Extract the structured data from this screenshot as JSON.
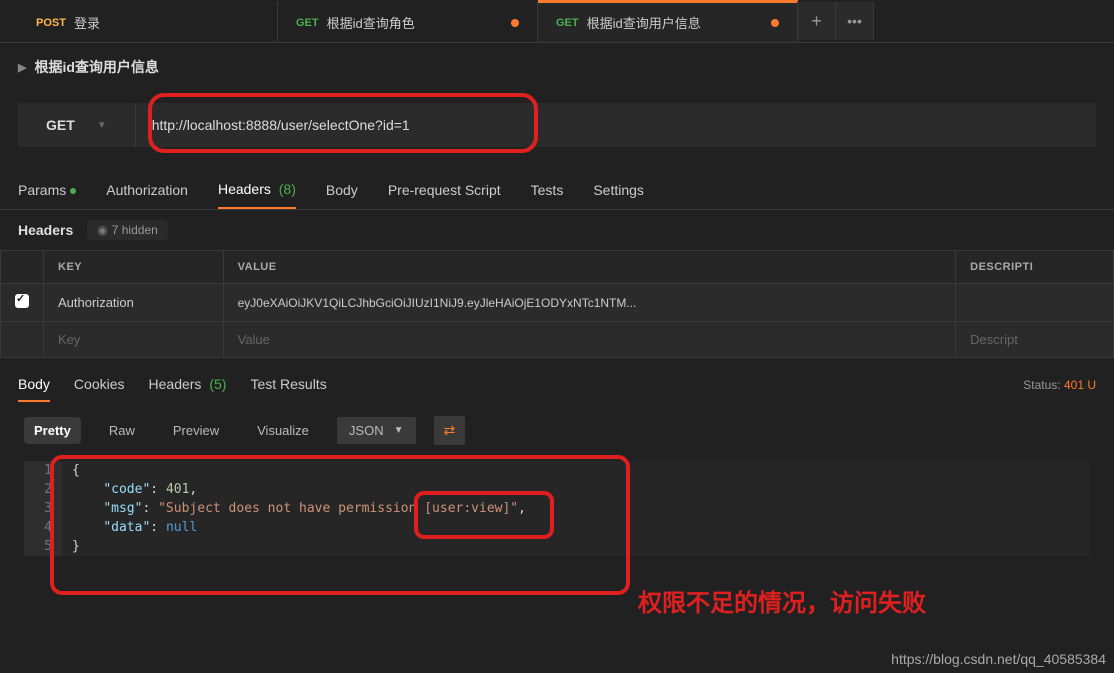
{
  "tabs": [
    {
      "method": "POST",
      "label": "登录",
      "modified": false
    },
    {
      "method": "GET",
      "label": "根据id查询角色",
      "modified": true
    },
    {
      "method": "GET",
      "label": "根据id查询用户信息",
      "modified": true,
      "active": true
    }
  ],
  "breadcrumb": "根据id查询用户信息",
  "request": {
    "method": "GET",
    "url": "http://localhost:8888/user/selectOne?id=1"
  },
  "req_tabs": {
    "params": "Params",
    "authorization": "Authorization",
    "headers": "Headers",
    "headers_count": "(8)",
    "body": "Body",
    "prerequest": "Pre-request Script",
    "tests": "Tests",
    "settings": "Settings"
  },
  "headers_sub": {
    "title": "Headers",
    "hidden": "7 hidden"
  },
  "table": {
    "cols": {
      "key": "KEY",
      "value": "VALUE",
      "desc": "DESCRIPTI"
    },
    "row": {
      "key": "Authorization",
      "value": "eyJ0eXAiOiJKV1QiLCJhbGciOiJIUzI1NiJ9.eyJleHAiOjE1ODYxNTc1NTM..."
    },
    "ph": {
      "key": "Key",
      "value": "Value",
      "desc": "Descript"
    }
  },
  "resp_tabs": {
    "body": "Body",
    "cookies": "Cookies",
    "headers": "Headers",
    "headers_count": "(5)",
    "tests": "Test Results"
  },
  "status": {
    "label": "Status:",
    "value": "401 U"
  },
  "view_tabs": {
    "pretty": "Pretty",
    "raw": "Raw",
    "preview": "Preview",
    "visualize": "Visualize",
    "format": "JSON"
  },
  "chart_data": {
    "type": "table",
    "json_lines": [
      {
        "n": "1",
        "raw": "{"
      },
      {
        "n": "2",
        "indent": "    ",
        "key": "\"code\"",
        "sep": ": ",
        "val": "401",
        "vtype": "num",
        "trail": ","
      },
      {
        "n": "3",
        "indent": "    ",
        "key": "\"msg\"",
        "sep": ": ",
        "val": "\"Subject does not have permission [user:view]\"",
        "vtype": "str",
        "trail": ","
      },
      {
        "n": "4",
        "indent": "    ",
        "key": "\"data\"",
        "sep": ": ",
        "val": "null",
        "vtype": "null",
        "trail": ""
      },
      {
        "n": "5",
        "raw": "}"
      }
    ]
  },
  "annotation": "权限不足的情况，访问失败",
  "watermark": "https://blog.csdn.net/qq_40585384"
}
